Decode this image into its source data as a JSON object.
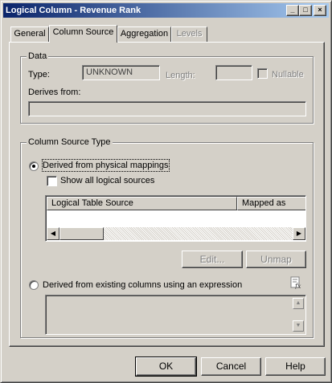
{
  "window": {
    "title": "Logical Column - Revenue Rank",
    "minimize_glyph": "_",
    "maximize_glyph": "□",
    "close_glyph": "×"
  },
  "tabs": [
    {
      "label": "General",
      "state": "normal"
    },
    {
      "label": "Column Source",
      "state": "active"
    },
    {
      "label": "Aggregation",
      "state": "normal"
    },
    {
      "label": "Levels",
      "state": "disabled"
    }
  ],
  "data_group": {
    "title": "Data",
    "type_label": "Type:",
    "type_value": "UNKNOWN",
    "length_label": "Length:",
    "length_value": "",
    "nullable_label": "Nullable",
    "nullable_checked": false,
    "derives_from_label": "Derives from:",
    "derives_from_value": ""
  },
  "source_group": {
    "title": "Column Source Type",
    "option_physical_label": "Derived from physical mappings",
    "option_physical_selected": true,
    "show_all_label": "Show all logical sources",
    "show_all_checked": false,
    "table_headers": [
      "Logical Table Source",
      "Mapped as"
    ],
    "table_rows": [],
    "edit_button": "Edit...",
    "unmap_button": "Unmap",
    "option_expression_label": "Derived from existing columns using an expression",
    "option_expression_selected": false,
    "expression_value": ""
  },
  "footer": {
    "ok_label": "OK",
    "cancel_label": "Cancel",
    "help_label": "Help"
  },
  "icons": {
    "scroll_left": "◀",
    "scroll_right": "▶",
    "scroll_up": "▲",
    "scroll_down": "▼",
    "expression_builder": "expression-builder-icon"
  }
}
